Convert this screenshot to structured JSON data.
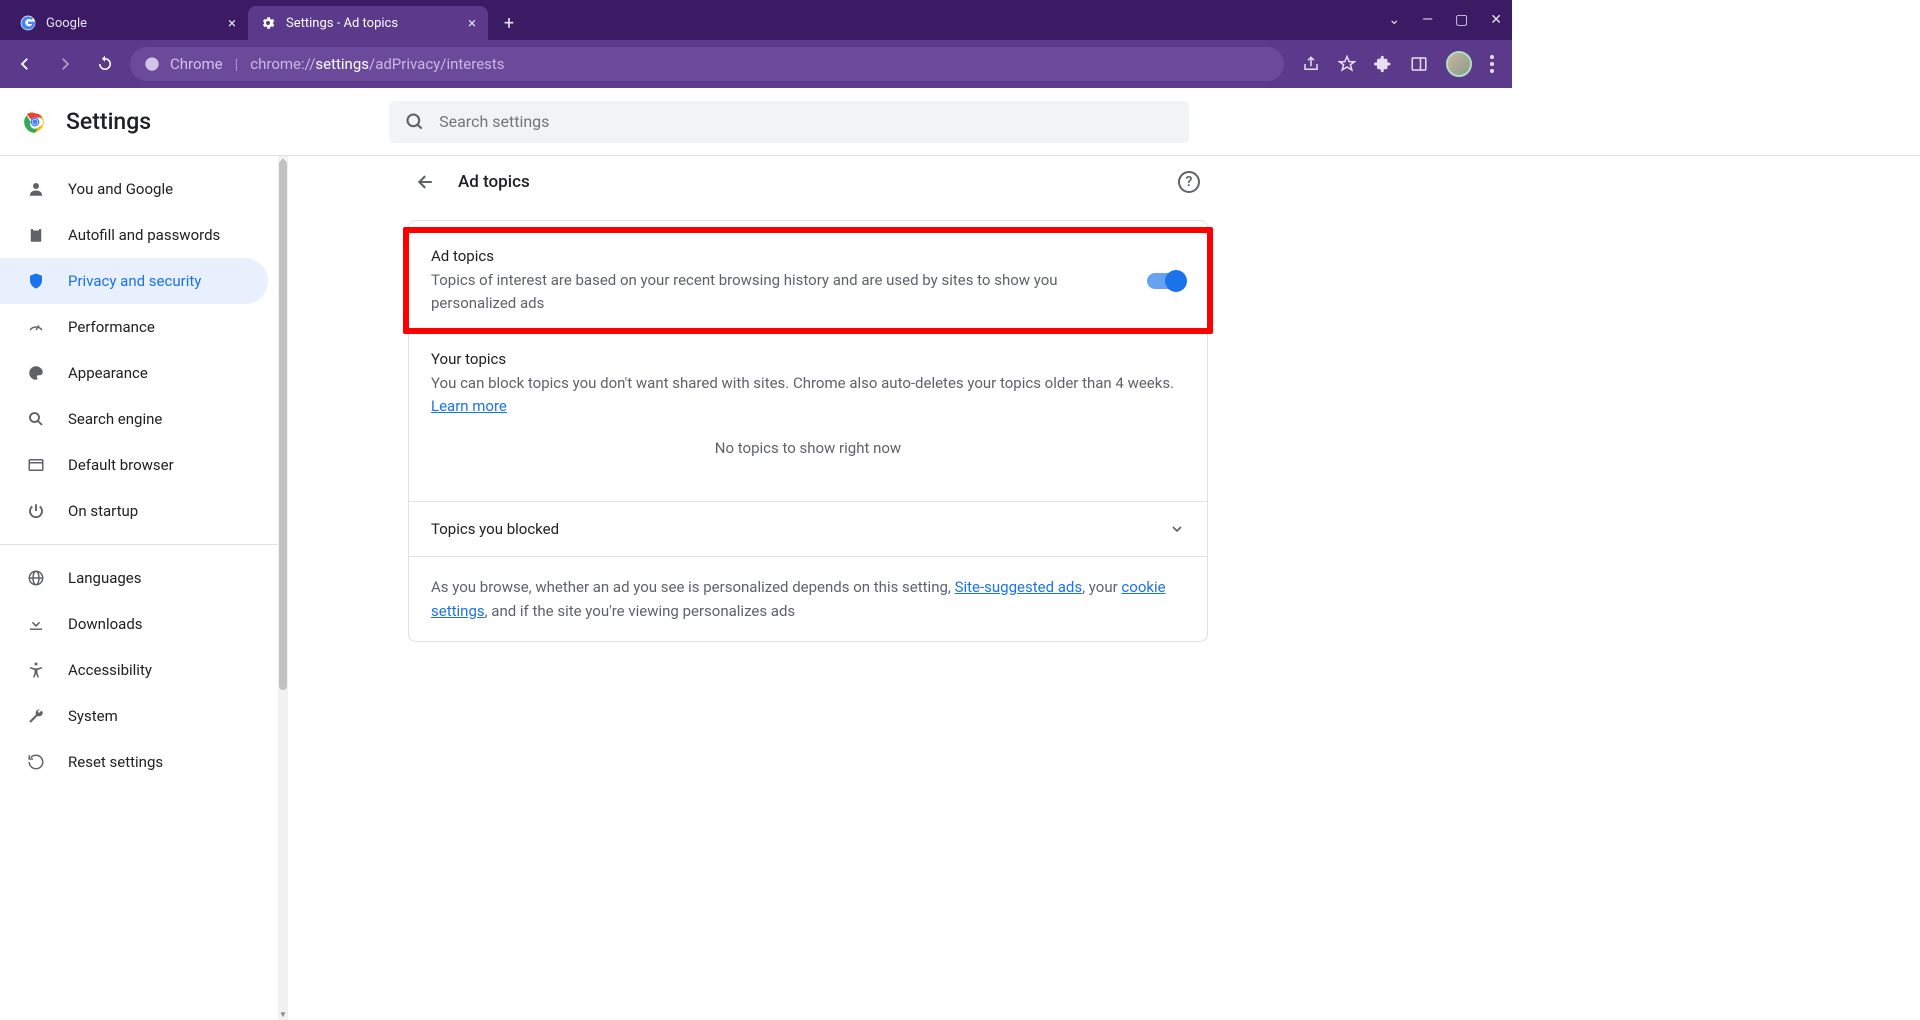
{
  "tabs": [
    {
      "title": "Google"
    },
    {
      "title": "Settings - Ad topics"
    }
  ],
  "address": {
    "scheme_label": "Chrome",
    "url_prefix": "chrome://",
    "url_mid": "settings",
    "url_rest": "/adPrivacy/interests"
  },
  "header": {
    "title": "Settings",
    "search_placeholder": "Search settings"
  },
  "sidebar": {
    "items": [
      {
        "label": "You and Google"
      },
      {
        "label": "Autofill and passwords"
      },
      {
        "label": "Privacy and security"
      },
      {
        "label": "Performance"
      },
      {
        "label": "Appearance"
      },
      {
        "label": "Search engine"
      },
      {
        "label": "Default browser"
      },
      {
        "label": "On startup"
      }
    ],
    "items2": [
      {
        "label": "Languages"
      },
      {
        "label": "Downloads"
      },
      {
        "label": "Accessibility"
      },
      {
        "label": "System"
      },
      {
        "label": "Reset settings"
      }
    ]
  },
  "panel": {
    "title": "Ad topics",
    "ad_topics": {
      "title": "Ad topics",
      "desc": "Topics of interest are based on your recent browsing history and are used by sites to show you personalized ads"
    },
    "your_topics": {
      "title": "Your topics",
      "desc_pre": "You can block topics you don't want shared with sites. Chrome also auto-deletes your topics older than 4 weeks. ",
      "learn_more": "Learn more",
      "empty": "No topics to show right now"
    },
    "blocked": {
      "title": "Topics you blocked"
    },
    "footnote": {
      "pre": "As you browse, whether an ad you see is personalized depends on this setting, ",
      "link1": "Site-suggested ads",
      "mid": ", your ",
      "link2": "cookie settings",
      "post": ", and if the site you're viewing personalizes ads"
    }
  }
}
